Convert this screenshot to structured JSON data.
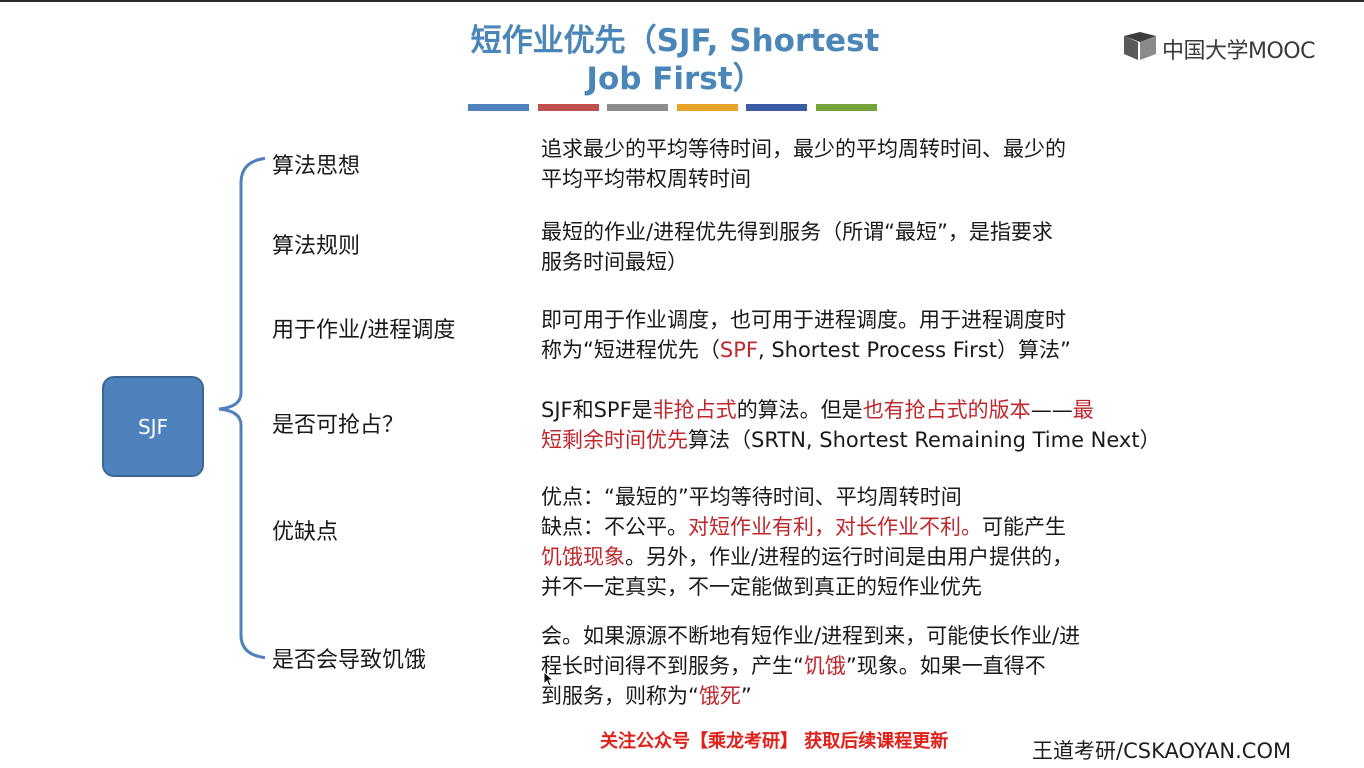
{
  "title": {
    "line1": "短作业优先（SJF, Shortest",
    "line2": "Job First）"
  },
  "colorbars": [
    "#4f81bd",
    "#c0504d",
    "#8c8c8c",
    "#e8a32b",
    "#3a5ca4",
    "#77a33b"
  ],
  "logo": {
    "text": "中国大学MOOC",
    "icon": "mooc-logo-icon"
  },
  "center_node": "SJF",
  "rows": [
    {
      "label": "算法思想",
      "lines": [
        [
          {
            "t": "追求最少的平均等待时间，最少的平均周转时间、最少的"
          }
        ],
        [
          {
            "t": "平均平均带权周转时间"
          }
        ]
      ]
    },
    {
      "label": "算法规则",
      "lines": [
        [
          {
            "t": "最短的作业/进程优先得到服务（所谓“最短”，是指要求"
          }
        ],
        [
          {
            "t": "服务时间最短）"
          }
        ]
      ]
    },
    {
      "label": "用于作业/进程调度",
      "lines": [
        [
          {
            "t": "即可用于作业调度，也可用于进程调度。用于进程调度时"
          }
        ],
        [
          {
            "t": "称为“短进程优先（"
          },
          {
            "t": "SPF",
            "red": true
          },
          {
            "t": ", Shortest Process First）算法”"
          }
        ]
      ]
    },
    {
      "label": "是否可抢占？",
      "lines": [
        [
          {
            "t": "SJF和SPF是"
          },
          {
            "t": "非抢占式",
            "red": true
          },
          {
            "t": "的算法。但是"
          },
          {
            "t": "也有抢占式的版本",
            "red": true
          },
          {
            "t": "——"
          },
          {
            "t": "最",
            "red": true
          }
        ],
        [
          {
            "t": "短剩余时间优先",
            "red": true
          },
          {
            "t": "算法（SRTN, Shortest Remaining Time Next）"
          }
        ]
      ]
    },
    {
      "label": "优缺点",
      "lines": [
        [
          {
            "t": "优点：“最短的”平均等待时间、平均周转时间"
          }
        ],
        [
          {
            "t": "缺点：不公平。"
          },
          {
            "t": "对短作业有利，对长作业不利。",
            "red": true
          },
          {
            "t": "可能产生"
          }
        ],
        [
          {
            "t": "饥饿现象",
            "red": true
          },
          {
            "t": "。另外，作业/进程的运行时间是由用户提供的，"
          }
        ],
        [
          {
            "t": "并不一定真实，不一定能做到真正的短作业优先"
          }
        ]
      ]
    },
    {
      "label": "是否会导致饥饿",
      "lines": [
        [
          {
            "t": "会。如果源源不断地有短作业/进程到来，可能使长作业/进"
          }
        ],
        [
          {
            "t": "程长时间得不到服务，产生“"
          },
          {
            "t": "饥饿",
            "red": true
          },
          {
            "t": "”现象。如果一直得不"
          }
        ],
        [
          {
            "t": "到服务，则称为“"
          },
          {
            "t": "饿死",
            "red": true
          },
          {
            "t": "”"
          }
        ]
      ]
    }
  ],
  "footer": {
    "promo": "关注公众号【乘龙考研】 获取后续课程更新",
    "site": "王道考研/CSKAOYAN.COM"
  }
}
